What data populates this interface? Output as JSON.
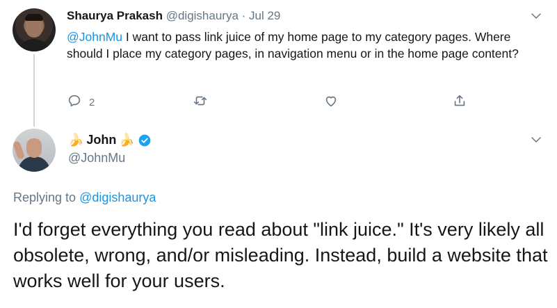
{
  "parent_tweet": {
    "author_name": "Shaurya Prakash",
    "author_handle": "@digishaurya",
    "separator": " · ",
    "date": "Jul 29",
    "mention": "@JohnMu",
    "text": " I want to pass link juice of my home page to my category pages. Where should I place my category pages, in navigation menu or in the home page content?",
    "reply_count": "2"
  },
  "reply_tweet": {
    "author_name": "John",
    "name_emoji_left": "🍌",
    "name_emoji_right": "🍌",
    "author_handle": "@JohnMu",
    "replying_prefix": "Replying to ",
    "replying_to": "@digishaurya",
    "text": "I'd forget everything you read about \"link juice.\" It's very likely all obsolete, wrong, and/or misleading. Instead, build a website that works well for your users."
  },
  "icons": {
    "reply": "reply-icon",
    "retweet": "retweet-icon",
    "like": "heart-icon",
    "share": "share-icon",
    "caret": "chevron-down-icon",
    "verified": "verified-badge-icon"
  },
  "colors": {
    "text": "#14171a",
    "muted": "#657786",
    "link": "#1b95e0",
    "verified": "#1da1f2",
    "thread_line": "#ccd6dd"
  }
}
